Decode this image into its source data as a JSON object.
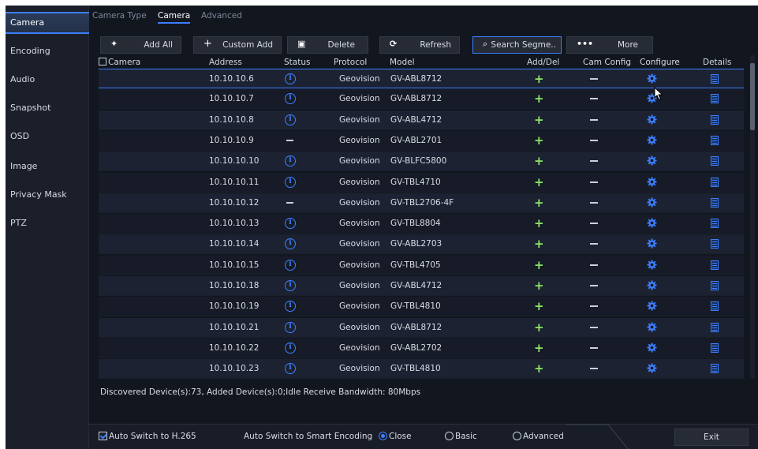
{
  "sidebar": {
    "items": [
      {
        "label": "Camera"
      },
      {
        "label": "Encoding"
      },
      {
        "label": "Audio"
      },
      {
        "label": "Snapshot"
      },
      {
        "label": "OSD"
      },
      {
        "label": "Image"
      },
      {
        "label": "Privacy Mask"
      },
      {
        "label": "PTZ"
      }
    ],
    "active": "Camera"
  },
  "tabs": [
    {
      "label": "Camera Type"
    },
    {
      "label": "Camera"
    },
    {
      "label": "Advanced"
    }
  ],
  "toolbar": {
    "add_all": "Add All",
    "custom_add": "Custom Add",
    "delete": "Delete",
    "refresh": "Refresh",
    "search": "Search Segme..",
    "more": "More"
  },
  "columns": {
    "camera": "Camera",
    "address": "Address",
    "status": "Status",
    "protocol": "Protocol",
    "model": "Model",
    "add_del": "Add/Del",
    "cam_config": "Cam Config",
    "configure": "Configure",
    "details": "Details"
  },
  "rows": [
    {
      "address": "10.10.10.6",
      "status": "info",
      "protocol": "Geovision",
      "model": "GV-ABL8712"
    },
    {
      "address": "10.10.10.7",
      "status": "info",
      "protocol": "Geovision",
      "model": "GV-ABL8712"
    },
    {
      "address": "10.10.10.8",
      "status": "info",
      "protocol": "Geovision",
      "model": "GV-ABL4712"
    },
    {
      "address": "10.10.10.9",
      "status": "none",
      "protocol": "Geovision",
      "model": "GV-ABL2701"
    },
    {
      "address": "10.10.10.10",
      "status": "info",
      "protocol": "Geovision",
      "model": "GV-BLFC5800"
    },
    {
      "address": "10.10.10.11",
      "status": "info",
      "protocol": "Geovision",
      "model": "GV-TBL4710"
    },
    {
      "address": "10.10.10.12",
      "status": "none",
      "protocol": "Geovision",
      "model": "GV-TBL2706-4F"
    },
    {
      "address": "10.10.10.13",
      "status": "info",
      "protocol": "Geovision",
      "model": "GV-TBL8804"
    },
    {
      "address": "10.10.10.14",
      "status": "info",
      "protocol": "Geovision",
      "model": "GV-ABL2703"
    },
    {
      "address": "10.10.10.15",
      "status": "info",
      "protocol": "Geovision",
      "model": "GV-TBL4705"
    },
    {
      "address": "10.10.10.18",
      "status": "info",
      "protocol": "Geovision",
      "model": "GV-ABL4712"
    },
    {
      "address": "10.10.10.19",
      "status": "info",
      "protocol": "Geovision",
      "model": "GV-TBL4810"
    },
    {
      "address": "10.10.10.21",
      "status": "info",
      "protocol": "Geovision",
      "model": "GV-ABL8712"
    },
    {
      "address": "10.10.10.22",
      "status": "info",
      "protocol": "Geovision",
      "model": "GV-ABL2702"
    },
    {
      "address": "10.10.10.23",
      "status": "info",
      "protocol": "Geovision",
      "model": "GV-TBL4810"
    }
  ],
  "summary": "Discovered Device(s):73, Added Device(s):0;Idle Receive Bandwidth: 80Mbps",
  "footer": {
    "auto_h265_label": "Auto Switch to H.265",
    "auto_h265_checked": true,
    "smart_encoding_label": "Auto Switch to Smart Encoding",
    "options": [
      {
        "label": "Close",
        "selected": true
      },
      {
        "label": "Basic",
        "selected": false
      },
      {
        "label": "Advanced",
        "selected": false
      }
    ],
    "exit": "Exit"
  },
  "colors": {
    "accent": "#3d7fff",
    "add_green": "#8ee36b",
    "background": "#12161f"
  }
}
